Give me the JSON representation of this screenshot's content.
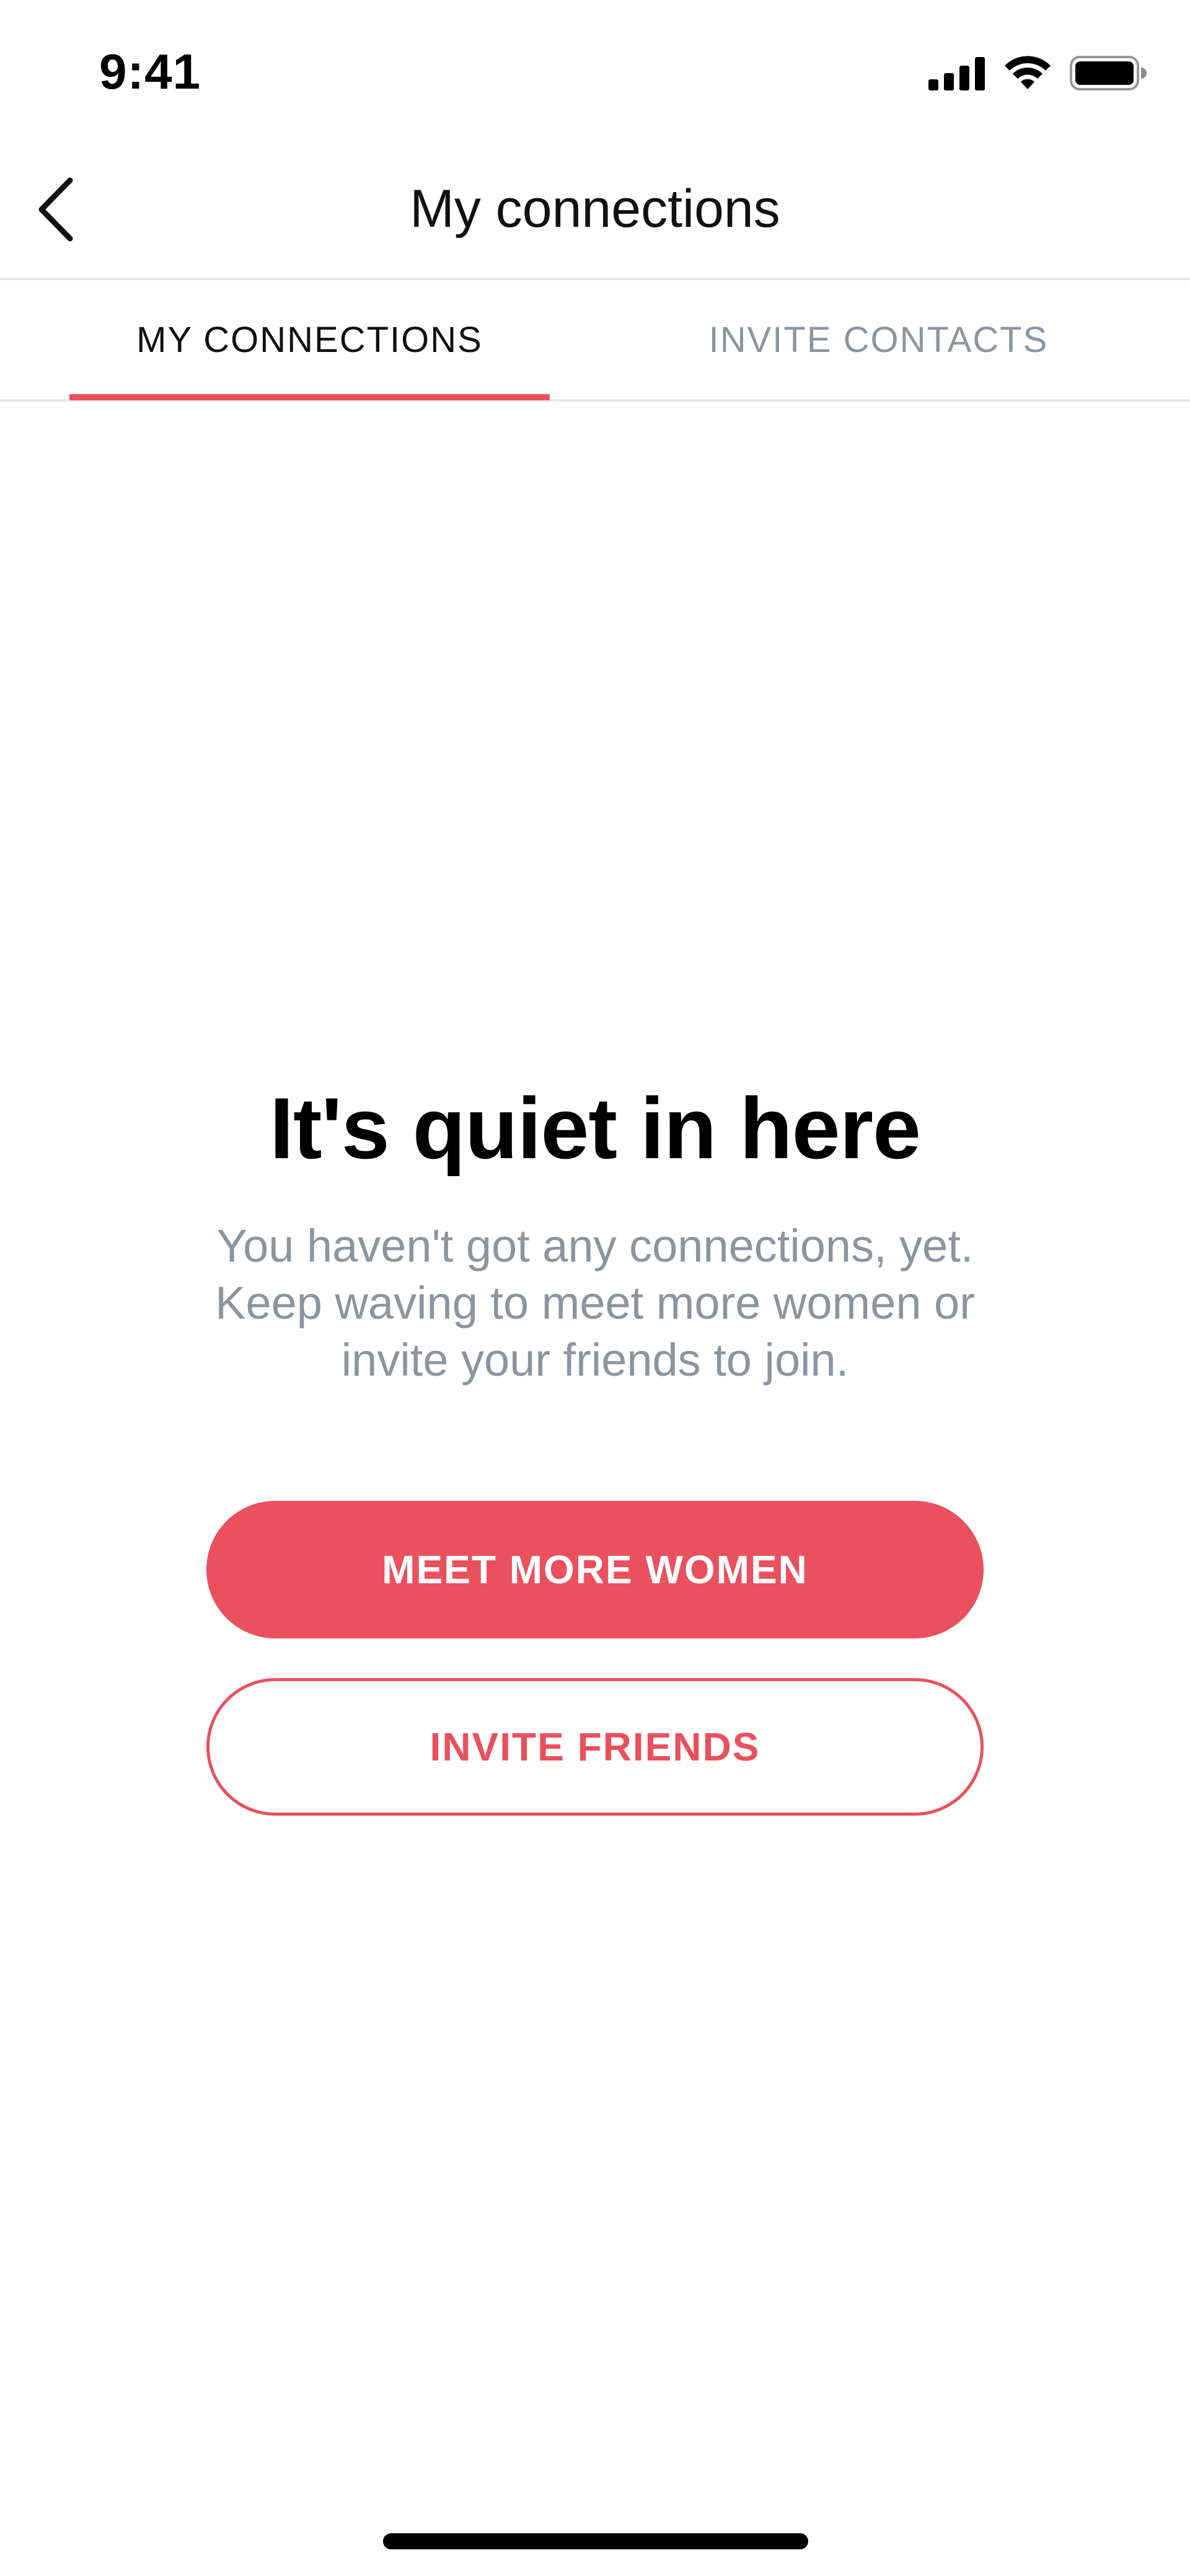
{
  "status_bar": {
    "time": "9:41",
    "icons": [
      "cellular-signal-icon",
      "wifi-icon",
      "battery-icon"
    ]
  },
  "nav": {
    "back_icon": "chevron-left-icon",
    "title": "My connections"
  },
  "tabs": [
    {
      "label": "MY CONNECTIONS",
      "selected": true
    },
    {
      "label": "INVITE CONTACTS",
      "selected": false
    }
  ],
  "empty_state": {
    "title": "It's quiet in here",
    "message": "You haven't got any connections, yet. Keep waving to meet more women or invite your friends to join."
  },
  "actions": {
    "primary_label": "MEET MORE WOMEN",
    "secondary_label": "INVITE FRIENDS"
  },
  "colors": {
    "accent": "#EA505D",
    "muted_text": "#8B95A0",
    "divider": "#E3E3E3"
  }
}
